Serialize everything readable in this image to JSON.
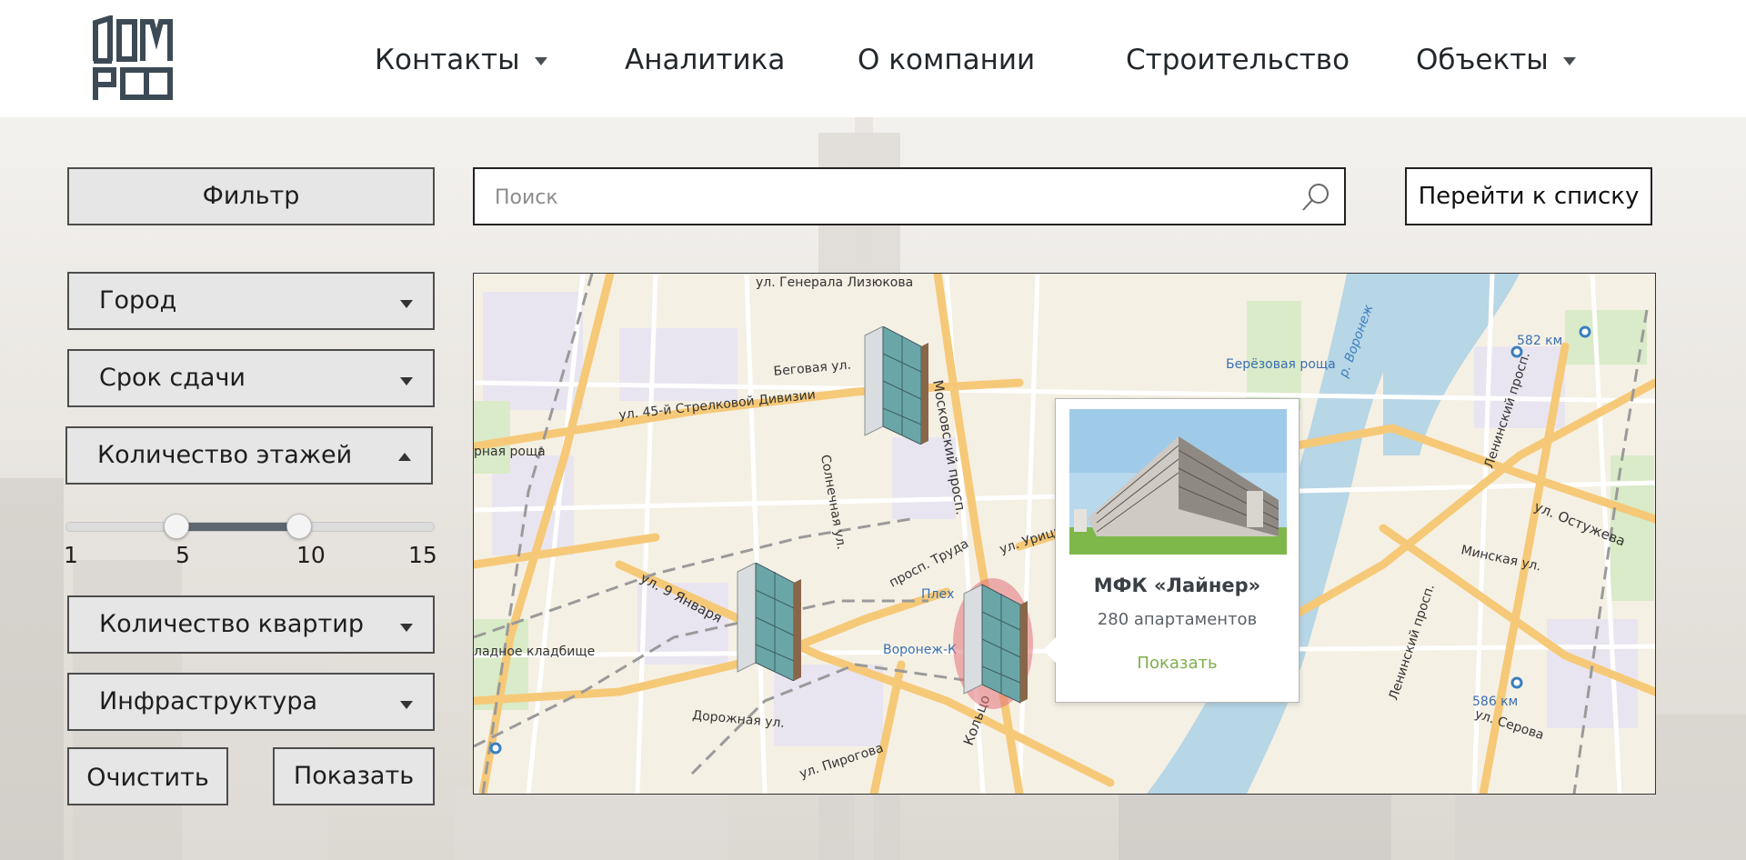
{
  "header": {
    "nav": [
      {
        "label": "Контакты",
        "has_caret": true
      },
      {
        "label": "Аналитика",
        "has_caret": false
      },
      {
        "label": "О компании",
        "has_caret": false
      },
      {
        "label": "Строительство",
        "has_caret": false
      },
      {
        "label": "Объекты",
        "has_caret": true
      }
    ]
  },
  "filter": {
    "title_button": "Фильтр",
    "city": "Город",
    "deadline": "Срок сдачи",
    "floors": "Количество этажей",
    "apartments": "Количество квартир",
    "infrastructure": "Инфраструктура",
    "clear_button": "Очистить",
    "show_button": "Показать",
    "floors_slider": {
      "min": 1,
      "max": 15,
      "low": 5,
      "high": 10,
      "ticks": [
        "1",
        "5",
        "10",
        "15"
      ]
    }
  },
  "search": {
    "placeholder": "Поиск"
  },
  "list_button": "Перейти к списку",
  "map": {
    "labels": [
      "ул. Генерала Лизюкова",
      "Беговая ул.",
      "ул. 45-й Стрелковой Дивизии",
      "Московский просп.",
      "Солнечная ул.",
      "просп. Труда",
      "ул. Урицк",
      "ул. 9 Января",
      "Кольцо",
      "Плех",
      "Воронеж-К",
      "Дорожная ул.",
      "ул. Пирогова",
      "Берёзовая роща",
      "р. Воронеж",
      "582 км",
      "Ленинский просп.",
      "ул. Остужева",
      "Минская ул.",
      "Ленинский просп.",
      "586 км",
      "ул. Серова",
      "рная роща",
      "ладное кладбище"
    ],
    "popup": {
      "title": "МФК «Лайнер»",
      "subtitle": "280 апартаментов",
      "action": "Показать"
    }
  }
}
